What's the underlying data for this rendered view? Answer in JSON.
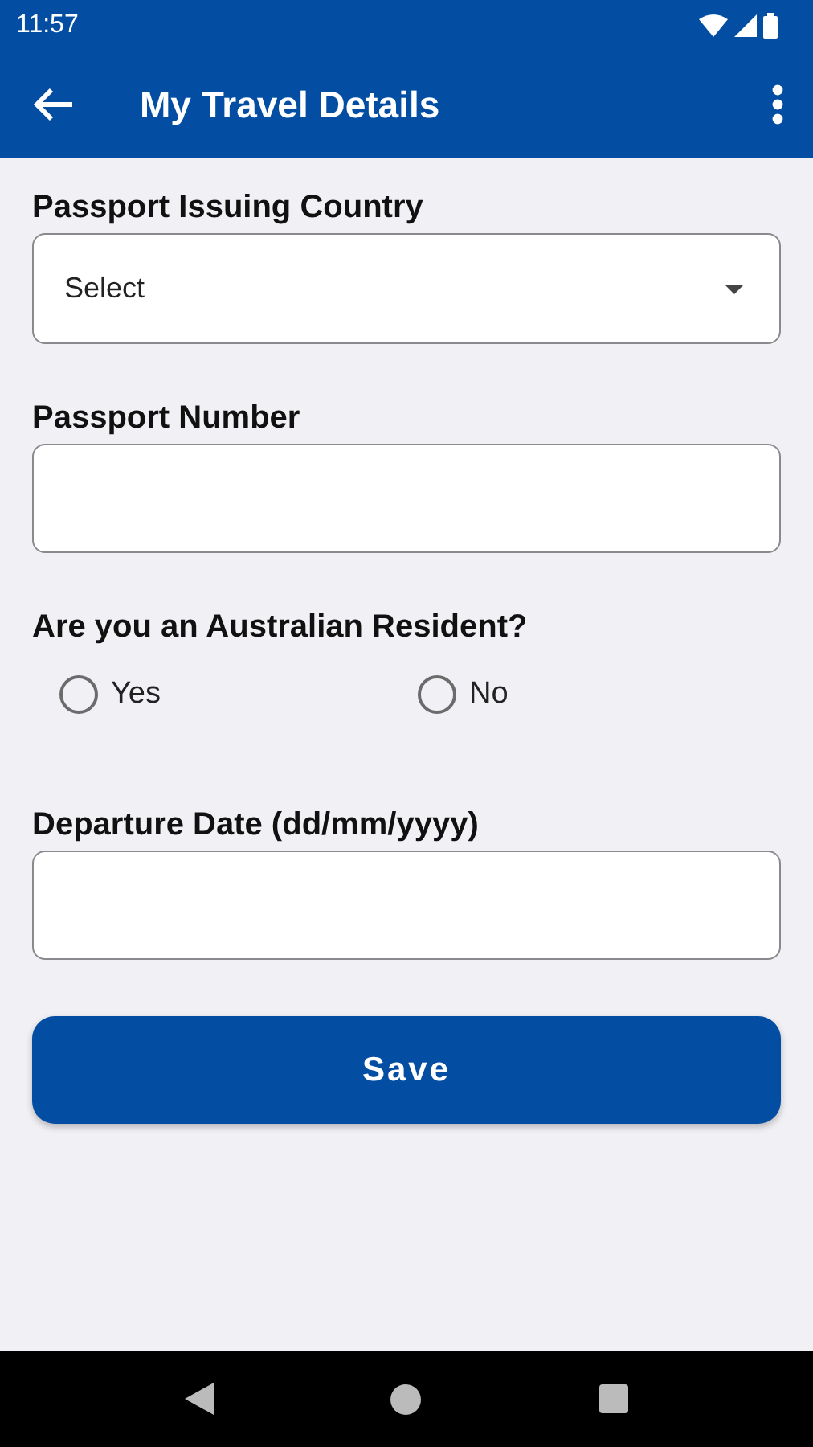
{
  "status_bar": {
    "time": "11:57"
  },
  "app_bar": {
    "title": "My Travel Details"
  },
  "fields": [
    {
      "kind": "select",
      "label": "Passport Issuing Country",
      "value": "Select"
    },
    {
      "kind": "text",
      "label": "Passport Number"
    },
    {
      "kind": "radio",
      "label": "Are you an Australian Resident?",
      "options": [
        {
          "label": "Yes",
          "selected": false
        },
        {
          "label": "No",
          "selected": false
        }
      ]
    },
    {
      "kind": "text",
      "label": "Departure Date (dd/mm/yyyy)"
    }
  ],
  "save_button": {
    "label": "Save"
  }
}
